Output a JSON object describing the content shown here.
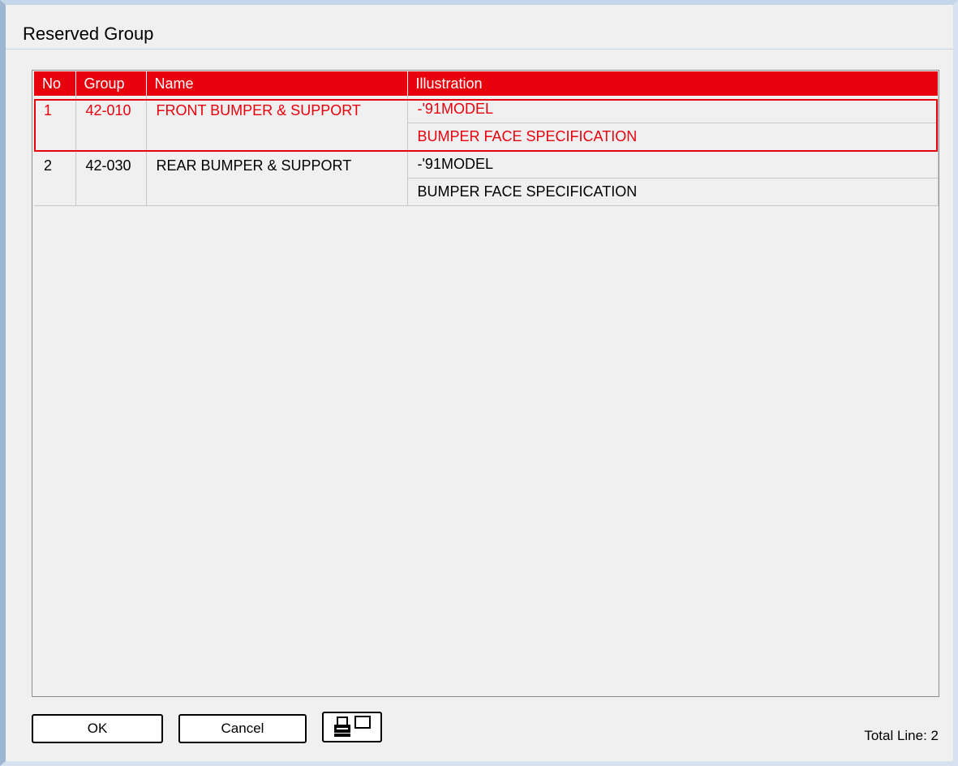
{
  "window": {
    "title": "Reserved Group"
  },
  "table": {
    "columns": [
      "No",
      "Group",
      "Name",
      "Illustration"
    ],
    "rows": [
      {
        "no": "1",
        "group": "42-010",
        "name": "FRONT BUMPER & SUPPORT",
        "illustrations": [
          "-'91MODEL",
          "BUMPER FACE SPECIFICATION"
        ],
        "selected": true
      },
      {
        "no": "2",
        "group": "42-030",
        "name": "REAR BUMPER & SUPPORT",
        "illustrations": [
          "-'91MODEL",
          "BUMPER FACE SPECIFICATION"
        ],
        "selected": false
      }
    ]
  },
  "footer": {
    "ok_label": "OK",
    "cancel_label": "Cancel",
    "print_icon": "print-preview-icon",
    "total_line": "Total Line: 2"
  },
  "colors": {
    "accent": "#e8000d",
    "background": "#f0f0f0"
  }
}
